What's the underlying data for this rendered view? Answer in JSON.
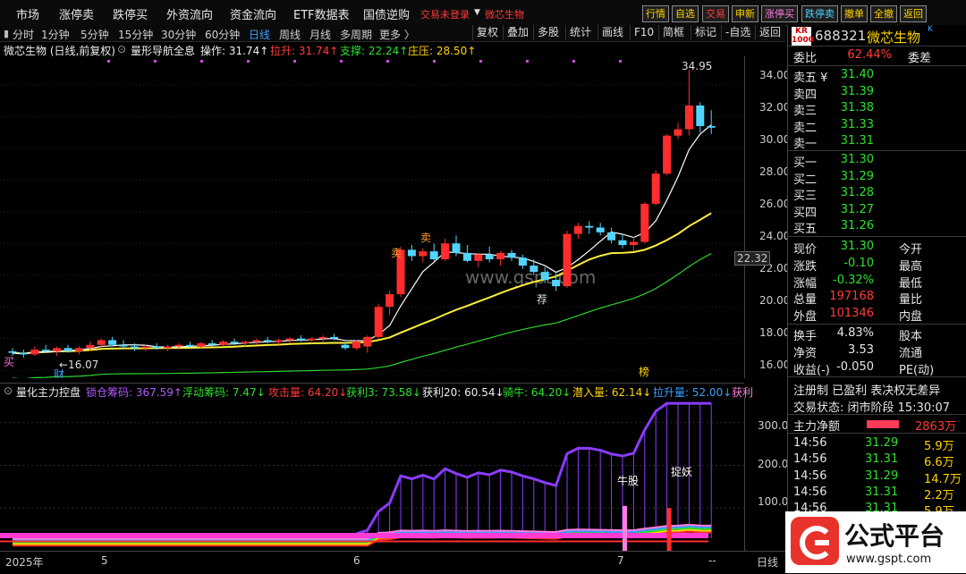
{
  "menu": {
    "items": [
      "市场",
      "涨停卖",
      "跌停买",
      "外资流向",
      "资金流向",
      "ETF数据表",
      "国债逆购"
    ],
    "warning": "交易未登录",
    "stock_dropdown": "微芯生物",
    "quick_buttons": [
      "行情",
      "自选",
      "交易",
      "申新",
      "涨停买",
      "跌停卖",
      "撤单",
      "全撤",
      "返回"
    ]
  },
  "periods": {
    "items": [
      "分时",
      "1分钟",
      "5分钟",
      "15分钟",
      "30分钟",
      "60分钟",
      "日线",
      "周线",
      "月线",
      "多周期",
      "更多 〉"
    ],
    "active": "日线"
  },
  "toolbar": [
    "复权",
    "叠加",
    "多股",
    "统计",
    "画线",
    "F10",
    "简框",
    "标记",
    "-自选",
    "返回"
  ],
  "main_header": {
    "title": "微芯生物 (日线,前复权)",
    "indicator": "量形导航全息",
    "op": "操作: 31.74↑",
    "up": "拉升: 31.74↑",
    "support": "支撑: 22.24↑",
    "zhuang": "庄压: 28.50↑"
  },
  "price_axis": [
    "34.00",
    "32.00",
    "30.00",
    "28.00",
    "26.00",
    "24.00",
    "22.00",
    "20.00",
    "18.00",
    "16.00"
  ],
  "price_tag": "22.32",
  "chart_labels": {
    "high": "34.95",
    "low": "16.07",
    "buy1": "卖",
    "buy2": "卖",
    "buy3": "买",
    "cai": "财",
    "jian": "荐",
    "bang": "榜",
    "watermark": "www.gspt.com"
  },
  "sub_header": {
    "name": "量化主力控盘",
    "a": "锁仓筹码: 367.59↑",
    "b": "浮动筹码: 7.47↓",
    "c": "攻击量: 64.20↓",
    "d": "获利3: 73.58↓",
    "e": "获利20: 60.54↓",
    "f": "骑牛: 64.20↓",
    "g": "潜入量: 62.14↓",
    "h": "拉升量: 52.00↓",
    "i": "获利"
  },
  "sub_axis": [
    "300.0",
    "200.0",
    "100.0"
  ],
  "sub_labels": {
    "niu": "牛股",
    "zhuo": "捉妖"
  },
  "time_axis": [
    "2025年",
    "5",
    "6",
    "7"
  ],
  "bottom_right": {
    "period": "日线",
    "dash": "--"
  },
  "quote": {
    "code": "688321",
    "name": "微芯生物",
    "webi_label": "委比",
    "webi": "62.44%",
    "wecha": "委差",
    "sells": [
      [
        "卖五 ¥",
        "31.40"
      ],
      [
        "卖四",
        "31.39"
      ],
      [
        "卖三",
        "31.38"
      ],
      [
        "卖二",
        "31.33"
      ],
      [
        "卖一",
        "31.31"
      ]
    ],
    "buys": [
      [
        "买一",
        "31.30"
      ],
      [
        "买二",
        "31.29"
      ],
      [
        "买三",
        "31.28"
      ],
      [
        "买四",
        "31.27"
      ],
      [
        "买五",
        "31.26"
      ]
    ],
    "stats": [
      [
        "现价",
        "31.30",
        "今开"
      ],
      [
        "涨跌",
        "-0.10",
        "最高"
      ],
      [
        "涨幅",
        "-0.32%",
        "最低"
      ],
      [
        "总量",
        "197168",
        "量比"
      ],
      [
        "外盘",
        "101346",
        "内盘"
      ]
    ],
    "stats2": [
      [
        "换手",
        "4.83%",
        "股本"
      ],
      [
        "净资",
        "3.53",
        "流通"
      ],
      [
        "收益(-)",
        "-0.050",
        "PE(动)"
      ]
    ],
    "flags": "注册制 已盈利 表决权无差异",
    "status": "交易状态: 闭市阶段 15:30:07",
    "netflow_label": "主力净额",
    "netflow": "2863万",
    "ticks": [
      [
        "14:56",
        "31.29",
        "5.9万"
      ],
      [
        "14:56",
        "31.31",
        "6.6万"
      ],
      [
        "14:56",
        "31.29",
        "14.7万"
      ],
      [
        "14:56",
        "31.31",
        "2.2万"
      ],
      [
        "14:56",
        "31.31",
        "5.9万"
      ]
    ]
  },
  "brand": {
    "name": "公式平台",
    "url": "www.gspt.com"
  },
  "colors": {
    "up": "#ff2d2d",
    "down": "#53d4ff",
    "ma5": "#ffffff",
    "ma20": "#ffef3a",
    "support": "#2ed42e",
    "purple": "#8a3cff"
  },
  "chart_data": {
    "type": "candlestick",
    "xlabel": "",
    "ylabel": "",
    "ylim": [
      15.5,
      35.8
    ],
    "candles": [
      [
        17.2,
        17.4,
        16.9,
        17.1
      ],
      [
        17.1,
        17.3,
        16.8,
        17.0
      ],
      [
        17.0,
        17.5,
        16.9,
        17.3
      ],
      [
        17.3,
        17.6,
        17.1,
        17.2
      ],
      [
        17.2,
        17.5,
        16.9,
        17.4
      ],
      [
        17.4,
        17.6,
        17.1,
        17.2
      ],
      [
        17.2,
        17.5,
        17.0,
        17.4
      ],
      [
        17.4,
        17.8,
        17.2,
        17.6
      ],
      [
        17.6,
        18.0,
        17.4,
        17.9
      ],
      [
        17.9,
        18.1,
        17.5,
        17.6
      ],
      [
        17.6,
        17.9,
        17.3,
        17.5
      ],
      [
        17.5,
        17.7,
        17.2,
        17.4
      ],
      [
        17.4,
        17.6,
        17.2,
        17.5
      ],
      [
        17.5,
        17.7,
        17.3,
        17.4
      ],
      [
        17.4,
        17.6,
        17.2,
        17.5
      ],
      [
        17.5,
        17.7,
        17.3,
        17.6
      ],
      [
        17.6,
        17.8,
        17.4,
        17.5
      ],
      [
        17.5,
        17.8,
        17.4,
        17.7
      ],
      [
        17.7,
        17.9,
        17.5,
        17.6
      ],
      [
        17.6,
        17.9,
        17.5,
        17.8
      ],
      [
        17.8,
        18.0,
        17.6,
        17.7
      ],
      [
        17.7,
        17.9,
        17.5,
        17.8
      ],
      [
        17.8,
        18.0,
        17.6,
        17.9
      ],
      [
        17.9,
        18.1,
        17.7,
        17.8
      ],
      [
        17.8,
        18.0,
        17.6,
        17.9
      ],
      [
        17.9,
        18.1,
        17.7,
        18.0
      ],
      [
        18.0,
        18.2,
        17.8,
        17.9
      ],
      [
        17.9,
        18.1,
        17.7,
        18.0
      ],
      [
        18.0,
        18.2,
        17.8,
        18.1
      ],
      [
        18.1,
        18.3,
        17.9,
        18.0
      ],
      [
        17.6,
        17.8,
        17.3,
        17.4
      ],
      [
        17.4,
        17.9,
        17.3,
        17.8
      ],
      [
        17.5,
        18.2,
        17.1,
        18.1
      ],
      [
        18.1,
        20.2,
        18.0,
        20.0
      ],
      [
        20.0,
        21.0,
        19.5,
        20.8
      ],
      [
        20.8,
        23.8,
        20.6,
        23.6
      ],
      [
        23.6,
        23.9,
        22.9,
        23.2
      ],
      [
        23.2,
        23.7,
        22.8,
        23.5
      ],
      [
        23.5,
        24.0,
        22.9,
        23.0
      ],
      [
        23.0,
        24.3,
        22.9,
        24.0
      ],
      [
        24.0,
        24.5,
        23.2,
        23.4
      ],
      [
        23.4,
        23.9,
        22.8,
        22.9
      ],
      [
        22.9,
        23.4,
        22.5,
        23.3
      ],
      [
        23.3,
        23.8,
        22.8,
        23.0
      ],
      [
        23.0,
        23.5,
        22.6,
        23.4
      ],
      [
        23.4,
        23.6,
        22.9,
        23.1
      ],
      [
        23.1,
        23.3,
        22.4,
        22.6
      ],
      [
        22.6,
        23.0,
        22.0,
        22.2
      ],
      [
        22.2,
        22.5,
        21.5,
        21.7
      ],
      [
        21.7,
        22.1,
        21.0,
        21.3
      ],
      [
        21.3,
        24.8,
        21.2,
        24.6
      ],
      [
        24.6,
        25.3,
        24.3,
        25.1
      ],
      [
        25.1,
        25.4,
        24.6,
        25.0
      ],
      [
        25.0,
        25.3,
        24.5,
        24.7
      ],
      [
        24.7,
        25.0,
        24.0,
        24.2
      ],
      [
        24.2,
        24.6,
        23.7,
        23.9
      ],
      [
        23.9,
        24.4,
        23.5,
        24.1
      ],
      [
        24.1,
        26.6,
        24.0,
        26.5
      ],
      [
        26.5,
        28.6,
        26.4,
        28.4
      ],
      [
        28.4,
        30.9,
        28.3,
        30.8
      ],
      [
        30.8,
        31.6,
        30.6,
        31.2
      ],
      [
        31.2,
        34.95,
        30.8,
        32.7
      ],
      [
        32.7,
        32.9,
        31.0,
        31.4
      ],
      [
        31.4,
        32.4,
        30.9,
        31.3
      ]
    ],
    "sub": {
      "name": "量化主力控盘",
      "ylim": [
        0,
        360
      ]
    }
  }
}
